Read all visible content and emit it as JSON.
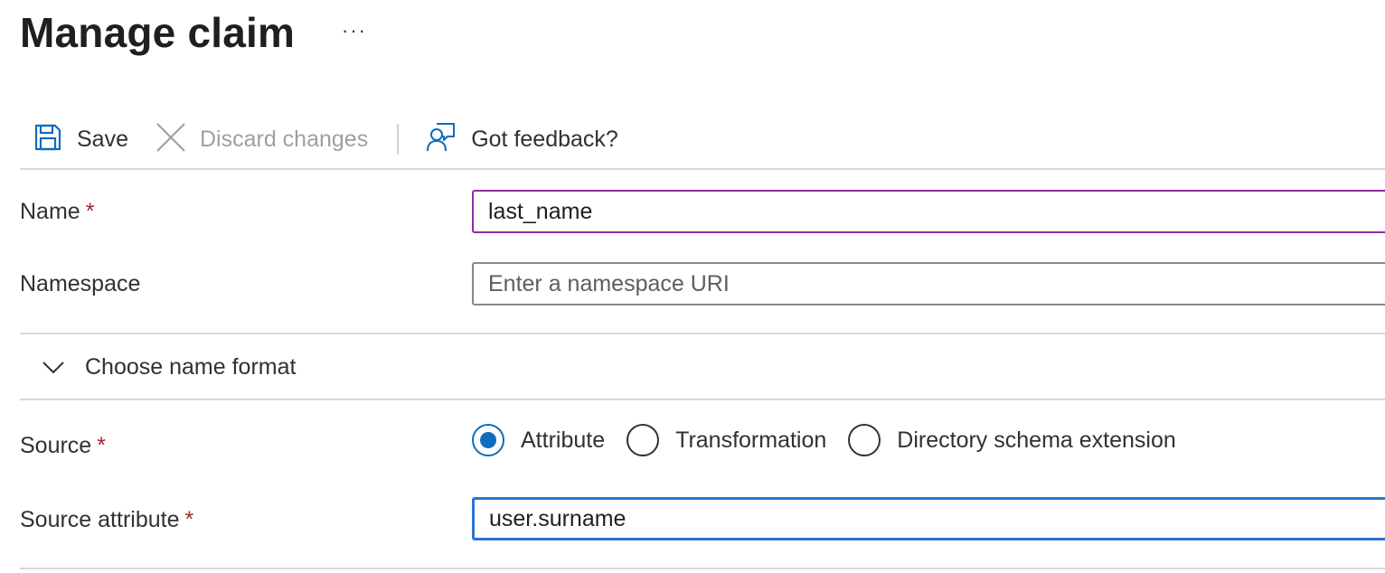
{
  "header": {
    "title": "Manage claim",
    "more_label": "···"
  },
  "toolbar": {
    "save_label": "Save",
    "discard_label": "Discard changes",
    "feedback_label": "Got feedback?"
  },
  "form": {
    "name": {
      "label": "Name",
      "required_mark": "*",
      "value": "last_name"
    },
    "namespace": {
      "label": "Namespace",
      "placeholder": "Enter a namespace URI",
      "value": ""
    },
    "name_format": {
      "label": "Choose name format",
      "expanded": false
    },
    "source": {
      "label": "Source",
      "required_mark": "*",
      "options": [
        {
          "label": "Attribute",
          "checked": true
        },
        {
          "label": "Transformation",
          "checked": false
        },
        {
          "label": "Directory schema extension",
          "checked": false
        }
      ]
    },
    "source_attribute": {
      "label": "Source attribute",
      "required_mark": "*",
      "value": "user.surname"
    }
  },
  "colors": {
    "accent": "#0f6cbd",
    "required": "#a4262c",
    "focus_purple": "#8a2da5",
    "disabled_text": "#a19f9d"
  }
}
